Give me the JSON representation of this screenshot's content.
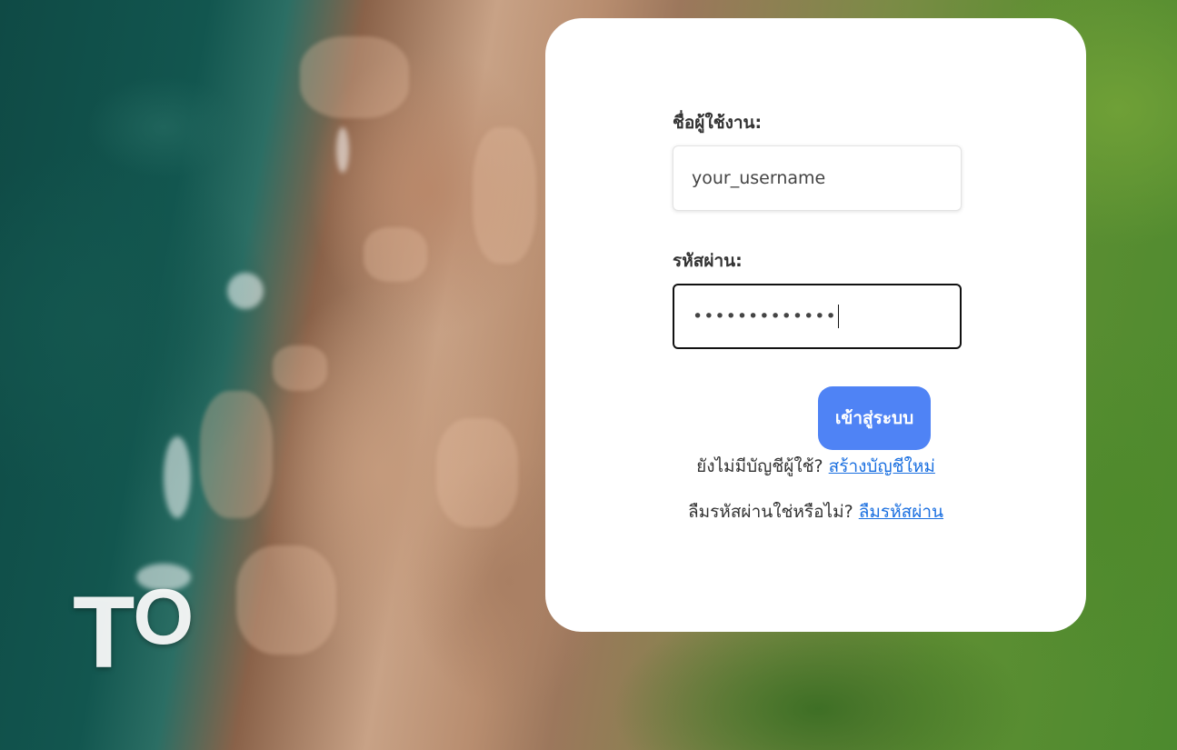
{
  "background": {
    "overlay_text": "TO",
    "overlay_text_first": "T",
    "overlay_text_second": "O"
  },
  "login": {
    "username_label": "ชื่อผู้ใช้งาน:",
    "username_value": "your_username",
    "password_label": "รหัสผ่าน:",
    "password_value": "•••••••••••••",
    "submit_label": "เข้าสู่ระบบ",
    "no_account_text": "ยังไม่มีบัญชีผู้ใช้? ",
    "create_account_link": "สร้างบัญชีใหม่",
    "forgot_text": "ลืมรหัสผ่านใช่หรือไม่? ",
    "forgot_link": "ลืมรหัสผ่าน"
  },
  "colors": {
    "button": "#4f83f5",
    "link": "#1a6fe0",
    "card": "#ffffff"
  }
}
